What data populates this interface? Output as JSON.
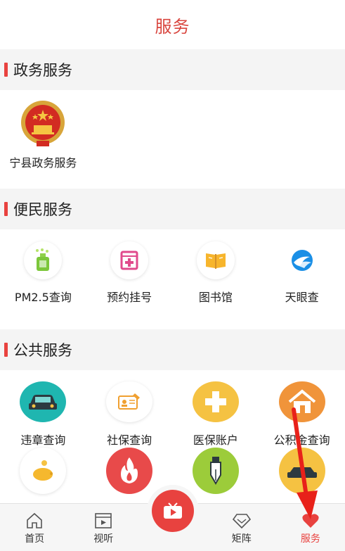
{
  "header": {
    "title": "服务"
  },
  "sections": {
    "gov": {
      "title": "政务服务",
      "items": [
        {
          "label": "宁县政务服务",
          "icon": "national-emblem-icon"
        }
      ]
    },
    "civic": {
      "title": "便民服务",
      "items": [
        {
          "label": "PM2.5查询",
          "icon": "air-purifier-icon"
        },
        {
          "label": "预约挂号",
          "icon": "medical-cross-icon"
        },
        {
          "label": "图书馆",
          "icon": "open-book-icon"
        },
        {
          "label": "天眼查",
          "icon": "tianyancha-logo-icon"
        }
      ]
    },
    "public": {
      "title": "公共服务",
      "items": [
        {
          "label": "违章查询",
          "icon": "car-icon"
        },
        {
          "label": "社保查询",
          "icon": "id-card-icon"
        },
        {
          "label": "医保账户",
          "icon": "plus-cross-icon"
        },
        {
          "label": "公积金查询",
          "icon": "house-icon"
        },
        {
          "label": "",
          "icon": "piggy-bank-icon"
        },
        {
          "label": "",
          "icon": "flame-icon"
        },
        {
          "label": "",
          "icon": "pen-nib-icon"
        },
        {
          "label": "",
          "icon": "car-wash-icon"
        }
      ]
    }
  },
  "tabs": [
    {
      "label": "首页",
      "icon": "home-icon"
    },
    {
      "label": "视听",
      "icon": "video-icon"
    },
    {
      "label": "",
      "icon": "tv-play-icon"
    },
    {
      "label": "矩阵",
      "icon": "diamond-icon"
    },
    {
      "label": "服务",
      "icon": "heart-icon",
      "active": true
    }
  ],
  "colors": {
    "accent": "#e8423f",
    "teal": "#1fb6b0",
    "orange": "#f0943a",
    "yellow": "#f5c242",
    "red": "#e84a4a",
    "green": "#9ccc3a"
  }
}
